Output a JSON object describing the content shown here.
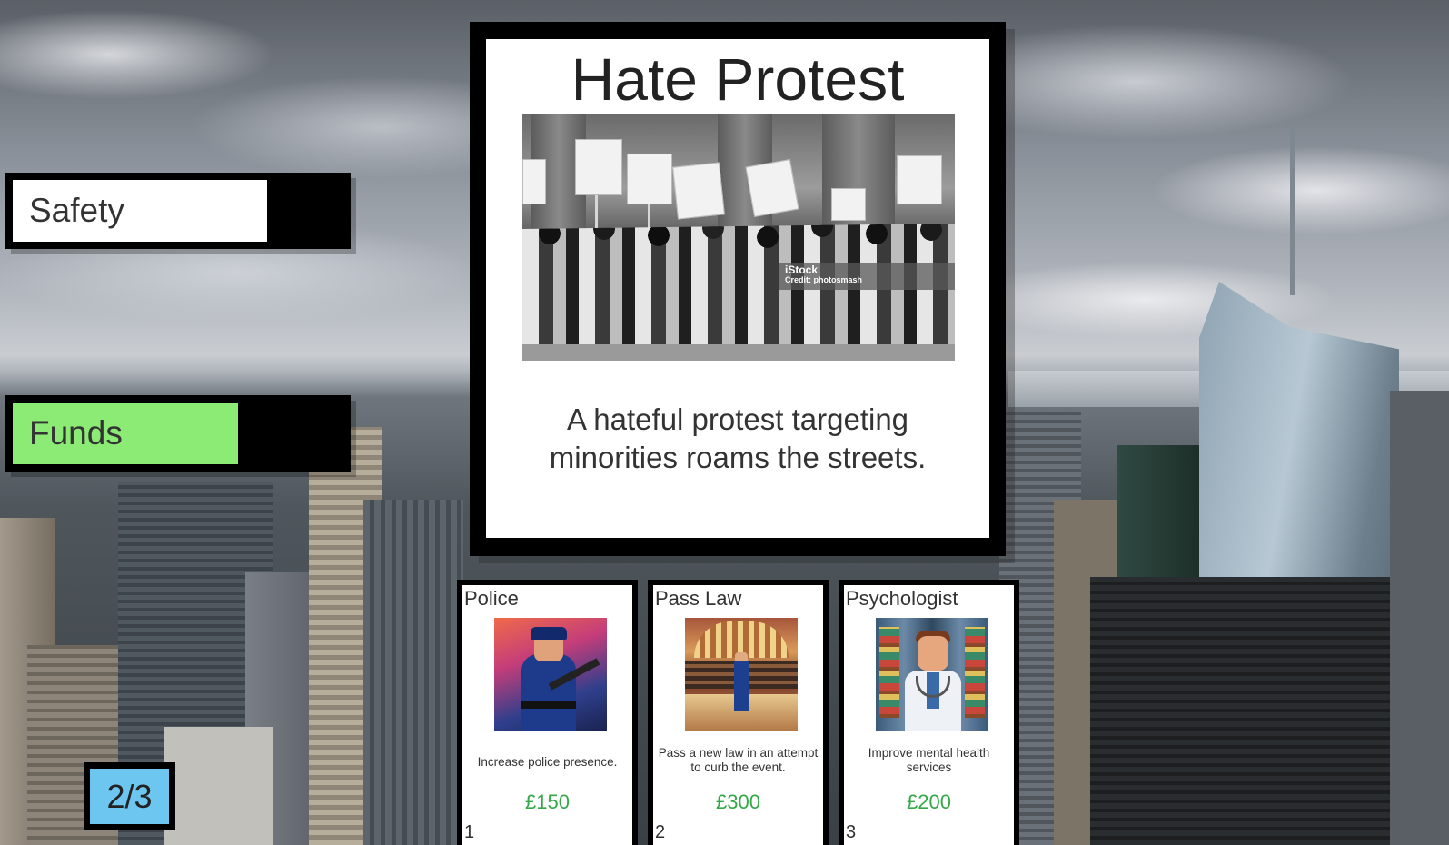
{
  "hud": {
    "safety_label": "Safety",
    "safety_level": 0.77,
    "funds_label": "Funds",
    "funds_level": 0.68,
    "turn_counter": "2/3",
    "colors": {
      "safety_fill": "#ffffff",
      "funds_fill": "#8beb74",
      "counter_bg": "#6cc6f0",
      "price": "#35a84a"
    }
  },
  "event": {
    "title": "Hate Protest",
    "description": "A hateful protest targeting minorities roams the streets.",
    "image_watermark": "iStock",
    "image_credit": "Credit: photosmash"
  },
  "choices": [
    {
      "name": "Police",
      "description": "Increase police presence.",
      "cost": "£150",
      "number": "1",
      "art": "police-officer-icon"
    },
    {
      "name": "Pass Law",
      "description": "Pass a new law in an attempt to curb the event.",
      "cost": "£300",
      "number": "2",
      "art": "parliament-icon"
    },
    {
      "name": "Psychologist",
      "description": "Improve mental health services",
      "cost": "£200",
      "number": "3",
      "art": "doctor-icon"
    }
  ]
}
